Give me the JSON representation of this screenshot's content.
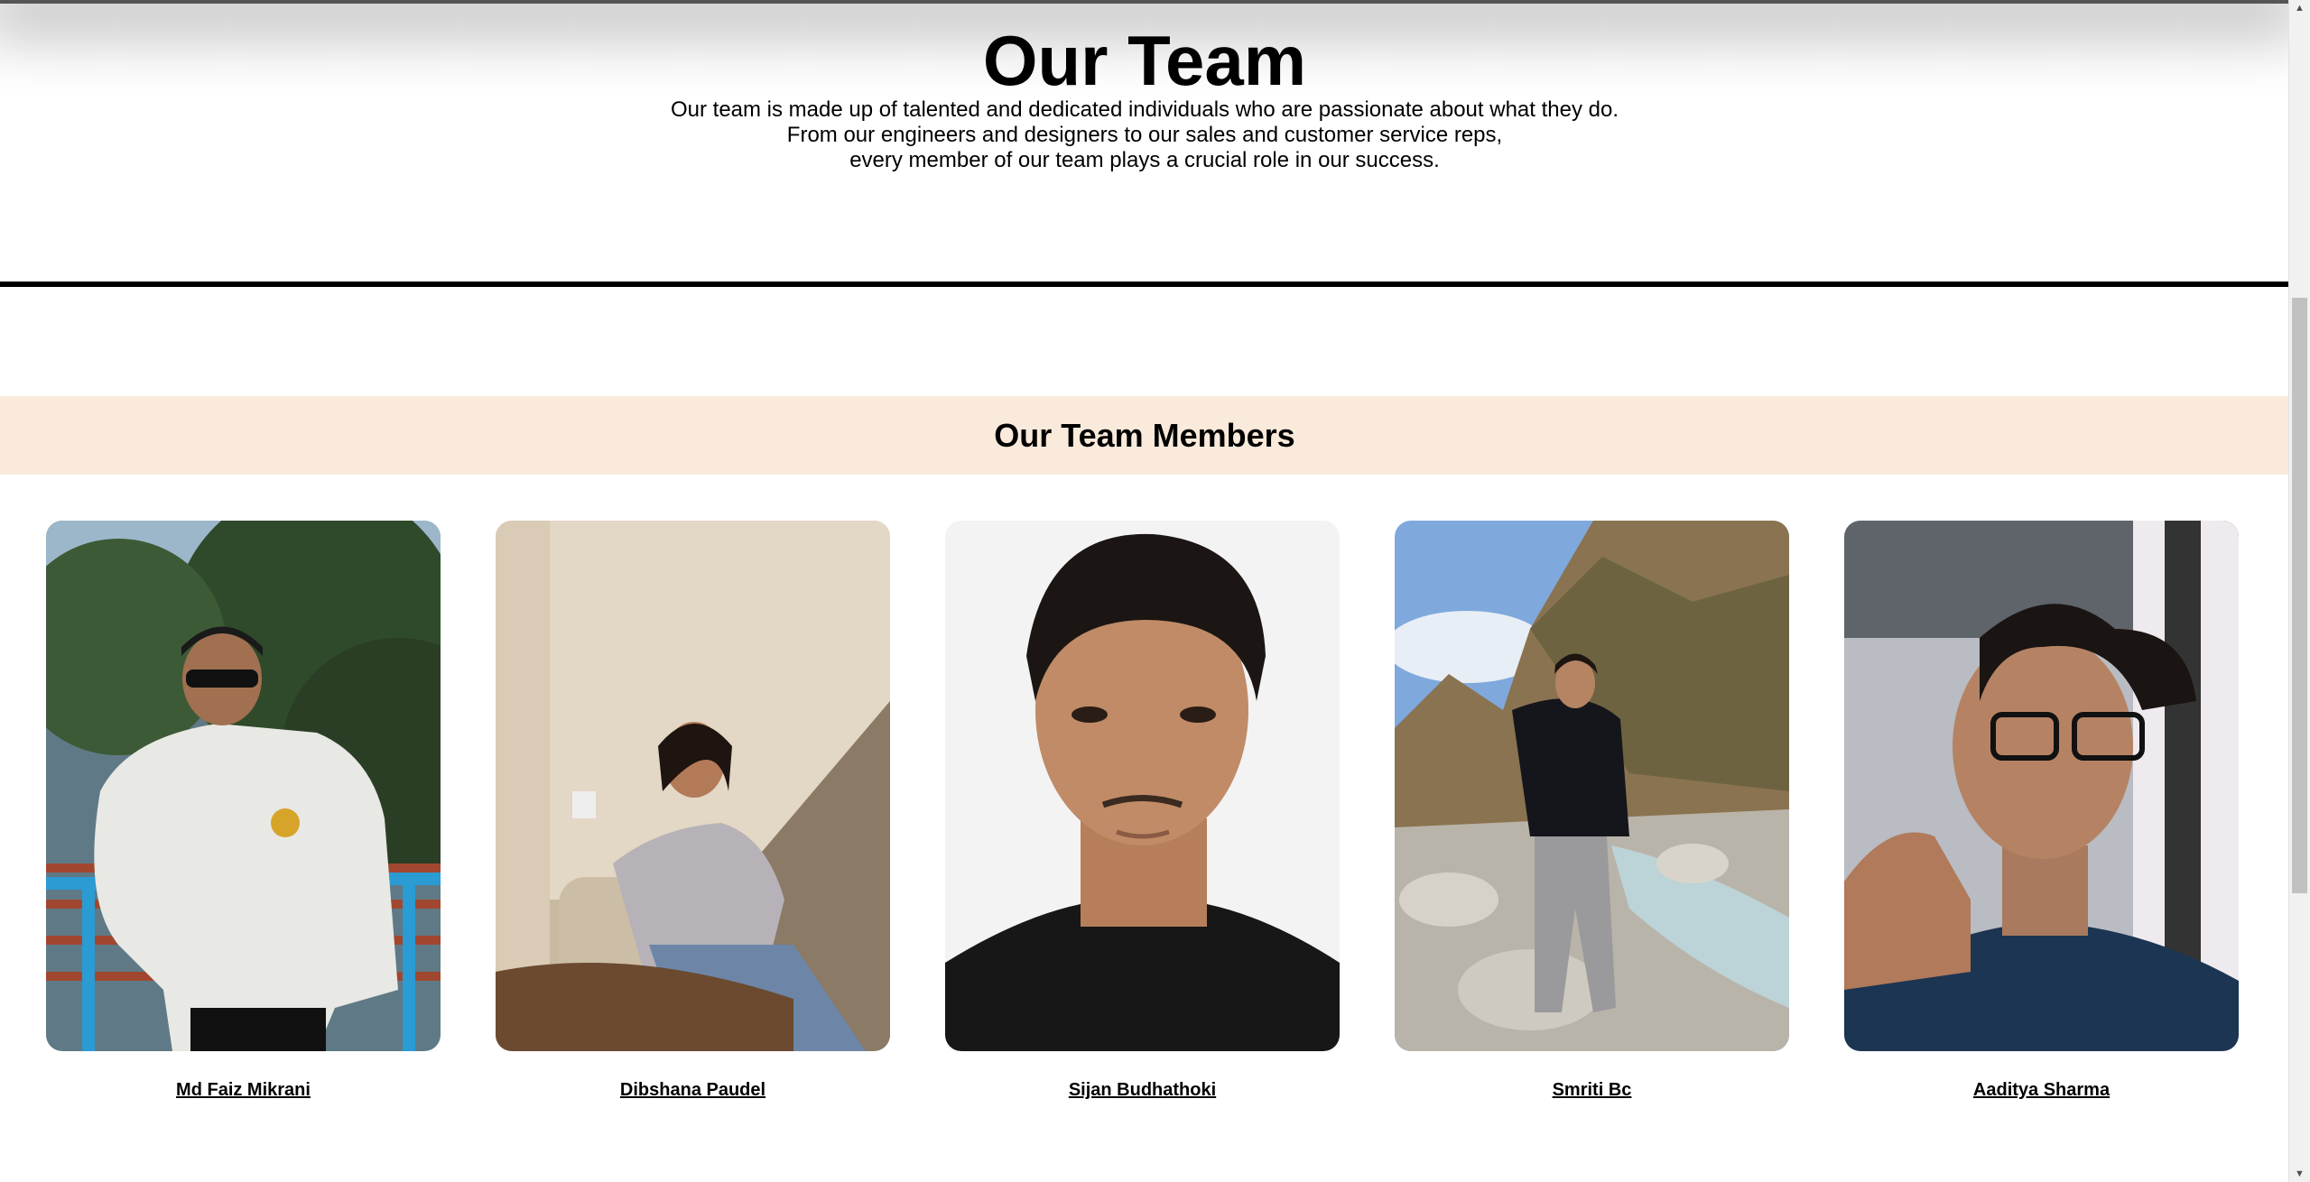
{
  "hero": {
    "title": "Our Team",
    "lines": [
      "Our team is made up of talented and dedicated individuals who are passionate about what they do.",
      "From our engineers and designers to our sales and customer service reps,",
      "every member of our team plays a crucial role in our success."
    ]
  },
  "members_section": {
    "title": "Our Team Members"
  },
  "members": [
    {
      "name": "Md Faiz Mikrani"
    },
    {
      "name": "Dibshana Paudel"
    },
    {
      "name": "Sijan Budhathoki"
    },
    {
      "name": "Smriti Bc"
    },
    {
      "name": "Aaditya Sharma"
    }
  ],
  "scrollbar": {
    "up_icon": "▲",
    "down_icon": "▼"
  },
  "colors": {
    "band": "#f9eadb",
    "divider": "#000000"
  }
}
